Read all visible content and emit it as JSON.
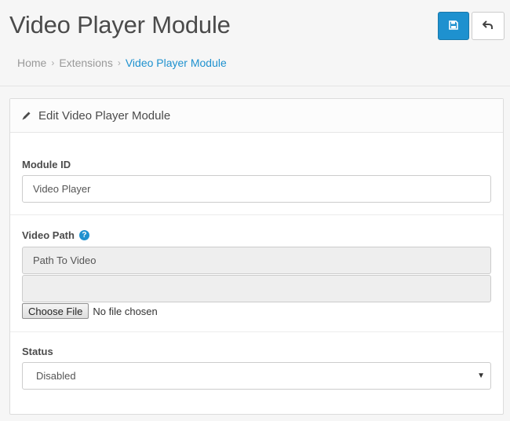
{
  "header": {
    "title": "Video Player Module",
    "save_icon": "floppy-disk-icon",
    "back_icon": "reply-arrow-icon",
    "accent_color": "#1e91cf"
  },
  "breadcrumb": {
    "items": [
      "Home",
      "Extensions",
      "Video Player Module"
    ],
    "separator": "›"
  },
  "panel": {
    "heading": "Edit Video Player Module",
    "heading_icon": "pencil-icon"
  },
  "form": {
    "module_id": {
      "label": "Module ID",
      "value": "Video Player"
    },
    "video_path": {
      "label": "Video Path",
      "help": "?",
      "value": "Path To Video",
      "second_value": "",
      "file_button": "Choose File",
      "file_status": "No file chosen"
    },
    "status": {
      "label": "Status",
      "value": "Disabled",
      "arrow": "▼"
    }
  }
}
